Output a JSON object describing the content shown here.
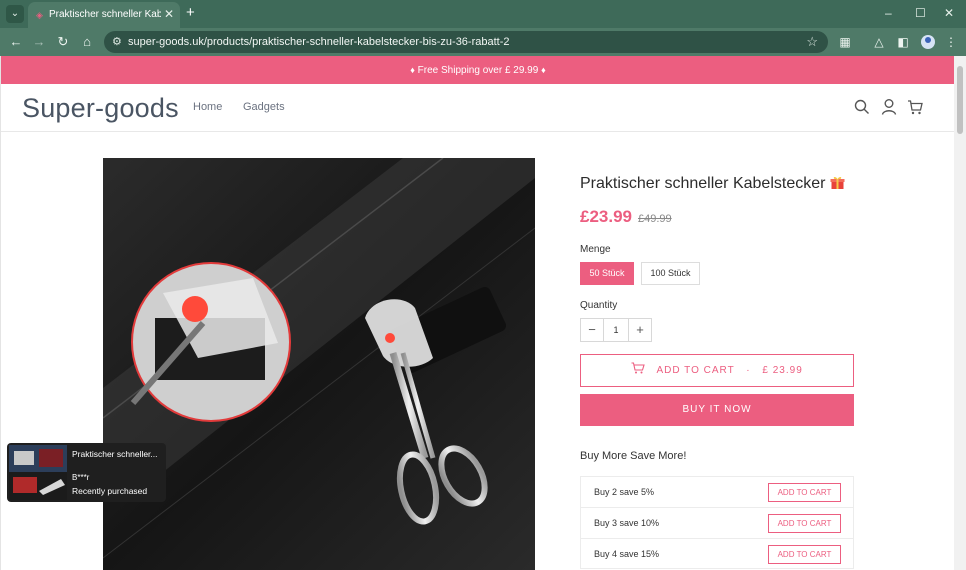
{
  "browser": {
    "tab_title": "Praktischer schneller Kabelstecker",
    "url": "super-goods.uk/products/praktischer-schneller-kabelstecker-bis-zu-36-rabatt-2"
  },
  "announcement": {
    "text": "Free Shipping over £ 29.99"
  },
  "header": {
    "logo": "Super-goods",
    "nav": [
      "Home",
      "Gadgets"
    ]
  },
  "product": {
    "title": "Praktischer schneller Kabelstecker",
    "price": "£23.99",
    "compare_price": "£49.99",
    "option_label": "Menge",
    "options": [
      {
        "label": "50 Stück",
        "selected": true
      },
      {
        "label": "100 Stück",
        "selected": false
      }
    ],
    "quantity_label": "Quantity",
    "quantity": "1",
    "add_to_cart": "ADD TO CART",
    "add_to_cart_price": "£ 23.99",
    "buy_now": "BUY IT NOW"
  },
  "bundle": {
    "title": "Buy More Save More!",
    "tiers": [
      {
        "label": "Buy 2 save 5%",
        "button": "ADD TO CART"
      },
      {
        "label": "Buy 3 save 10%",
        "button": "ADD TO CART"
      },
      {
        "label": "Buy 4 save 15%",
        "button": "ADD TO CART"
      }
    ]
  },
  "popup": {
    "title": "Praktischer schneller...",
    "buyer": "B***r",
    "status": "Recently purchased"
  },
  "colors": {
    "accent": "#ec5e80",
    "browser_frame": "#3e6a59"
  }
}
